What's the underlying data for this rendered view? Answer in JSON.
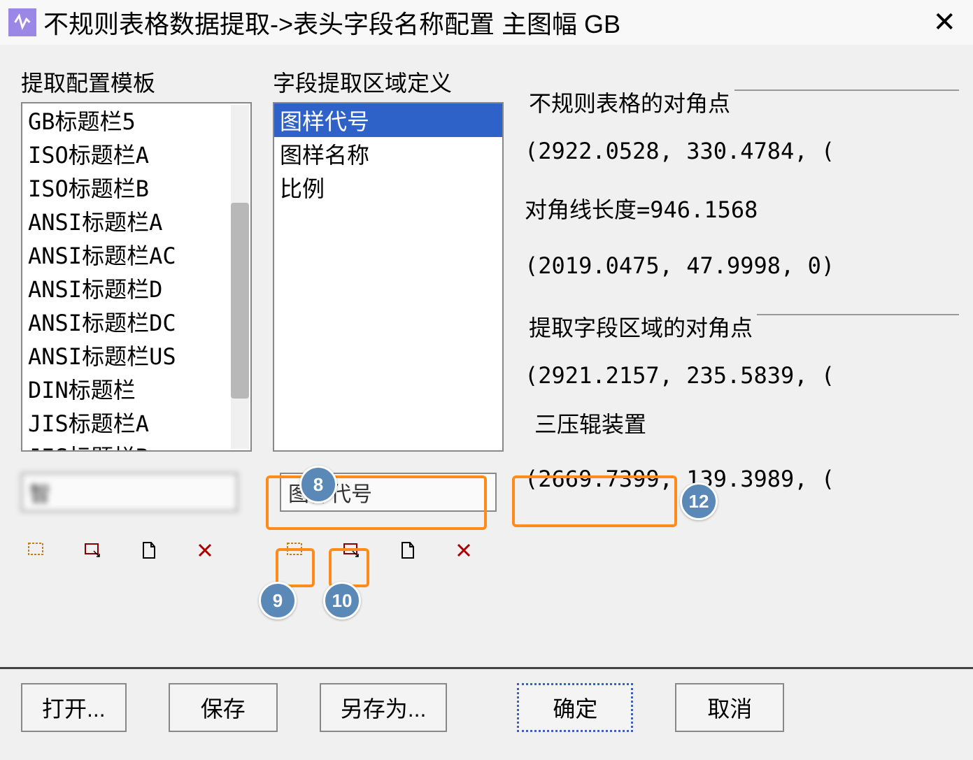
{
  "window": {
    "title": "不规则表格数据提取->表头字段名称配置 主图幅 GB"
  },
  "templates": {
    "label": "提取配置模板",
    "items": [
      "GB标题栏5",
      "ISO标题栏A",
      "ISO标题栏B",
      "ANSI标题栏A",
      "ANSI标题栏AC",
      "ANSI标题栏D",
      "ANSI标题栏DC",
      "ANSI标题栏US",
      "DIN标题栏",
      "JIS标题栏A",
      "JIS标题栏B",
      "智"
    ],
    "selected_index": 11,
    "input_value": "智"
  },
  "fields": {
    "label": "字段提取区域定义",
    "items": [
      "图样代号",
      "图样名称",
      "比例"
    ],
    "selected_index": 0,
    "input_value": "图样代号"
  },
  "table_corner": {
    "title": "不规则表格的对角点",
    "p1": "(2922.0528, 330.4784, (",
    "diag": "对角线长度=946.1568",
    "p2": "(2019.0475, 47.9998, 0)"
  },
  "field_corner": {
    "title": "提取字段区域的对角点",
    "p1": "(2921.2157, 235.5839, (",
    "value": "三压辊装置",
    "p2": "(2669.7399, 139.3989, ("
  },
  "buttons": {
    "open": "打开...",
    "save": "保存",
    "saveas": "另存为...",
    "ok": "确定",
    "cancel": "取消"
  },
  "callouts": {
    "c8": "8",
    "c9": "9",
    "c10": "10",
    "c12": "12"
  }
}
